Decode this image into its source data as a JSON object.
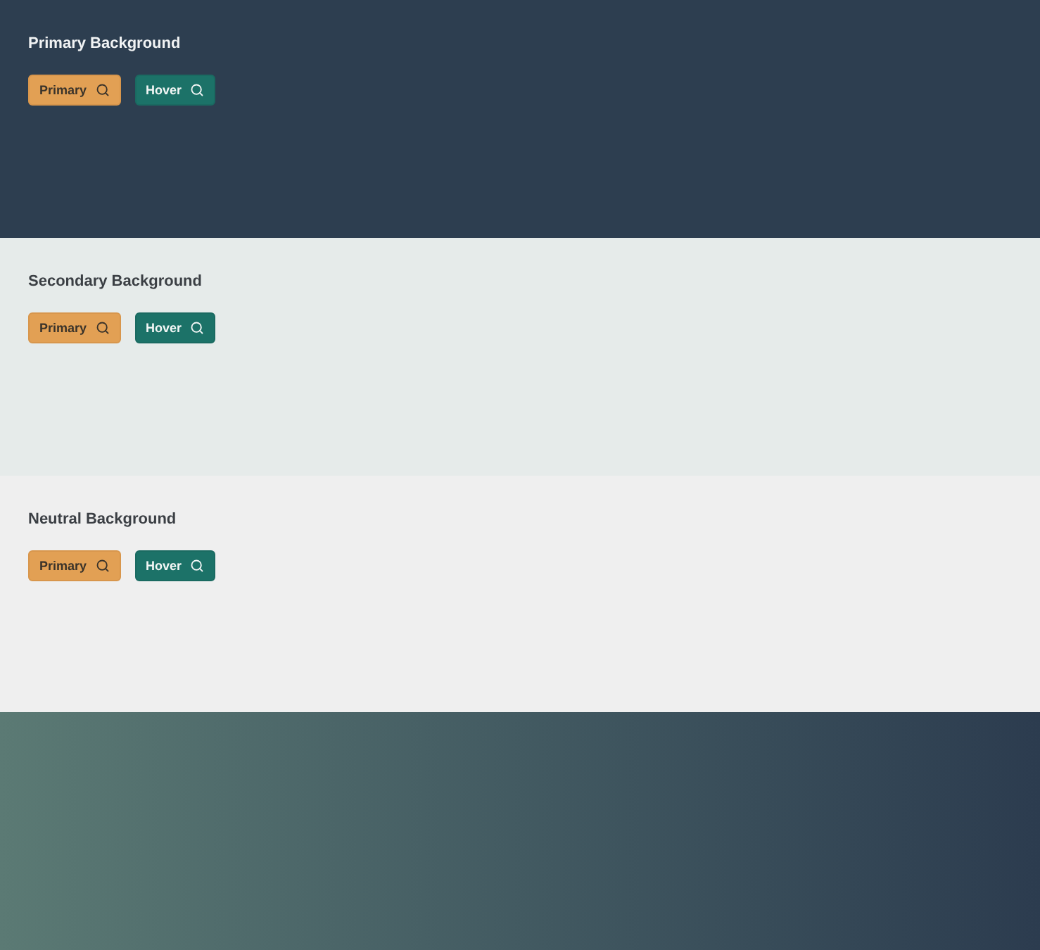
{
  "sections": [
    {
      "kind": "primary",
      "title": "Primary Background",
      "buttons": [
        {
          "label": "Primary",
          "kind": "primary"
        },
        {
          "label": "Hover",
          "kind": "hover"
        }
      ]
    },
    {
      "kind": "secondary",
      "title": "Secondary Background",
      "buttons": [
        {
          "label": "Primary",
          "kind": "primary"
        },
        {
          "label": "Hover",
          "kind": "hover"
        }
      ]
    },
    {
      "kind": "neutral",
      "title": "Neutral Background",
      "buttons": [
        {
          "label": "Primary",
          "kind": "primary"
        },
        {
          "label": "Hover",
          "kind": "hover"
        }
      ]
    },
    {
      "kind": "gradient"
    }
  ]
}
